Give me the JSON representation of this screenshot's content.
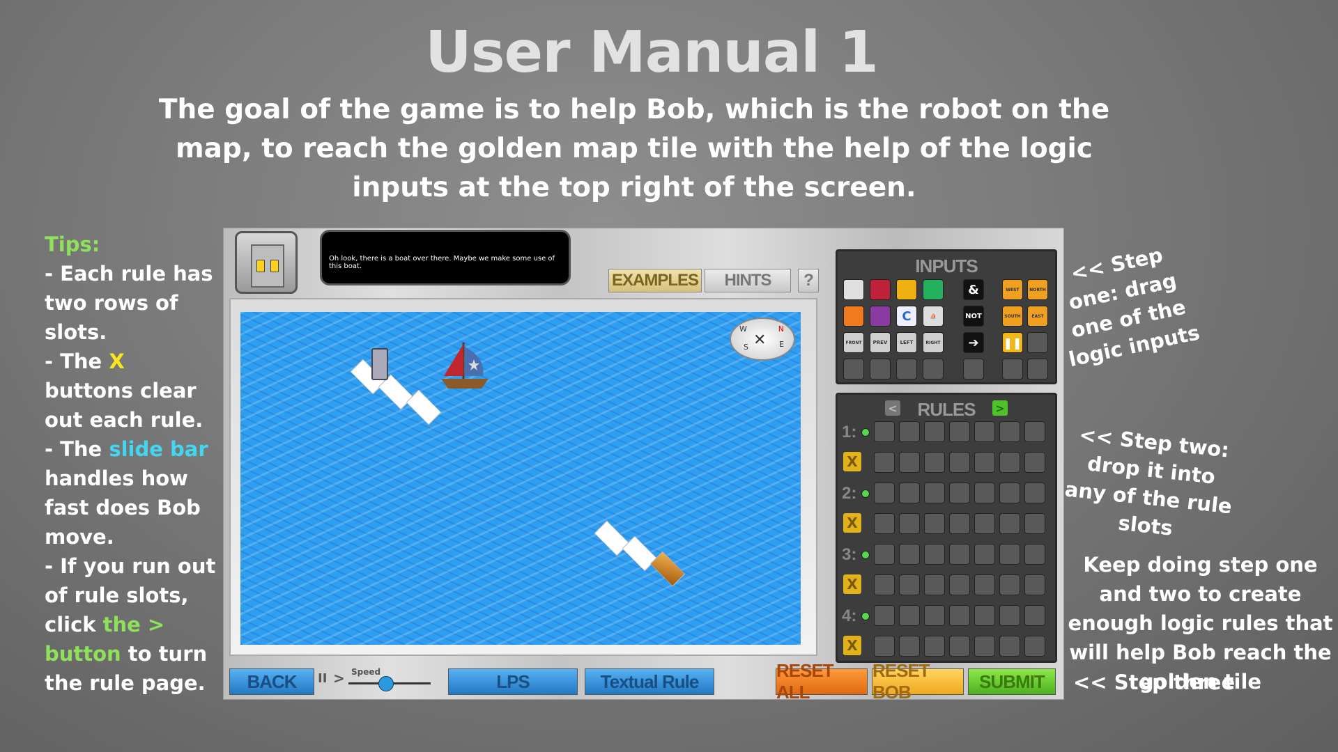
{
  "title": "User Manual 1",
  "intro": "The goal of the game is to help Bob, which is the robot on the map, to reach the golden map tile with the help of the logic inputs at the top right of the screen.",
  "tips": {
    "heading": "Tips:",
    "line1": "- Each rule has two rows of slots.",
    "line2_pre": "- The ",
    "line2_x": "X",
    "line2_post": " buttons clear out each rule.",
    "line3_pre": "- The ",
    "line3_highlight": "slide bar",
    "line3_post": " handles how fast does Bob move.",
    "line4_pre": "- If you run out of rule slots, click ",
    "line4_highlight": "the > button",
    "line4_post": " to turn the rule page."
  },
  "notes": {
    "step1": "<< Step one: drag one of the logic inputs",
    "step2": "<< Step two: drop it into any of the rule slots",
    "step3": "Keep doing step one and two to create enough logic rules that will help Bob reach the golden tile",
    "step4": "<< Step three"
  },
  "game": {
    "speech": "Oh look, there is a boat over there. Maybe we make some use of this boat.",
    "buttons": {
      "examples": "EXAMPLES",
      "hints": "HINTS",
      "help": "?",
      "back": "BACK",
      "pause": "II",
      "play": ">",
      "speed": "Speed",
      "lps": "LPS",
      "textual_rule": "Textual Rule",
      "reset_all": "RESET ALL",
      "reset_bob": "RESET BOB",
      "submit": "SUBMIT"
    },
    "compass": {
      "w": "W",
      "n": "N",
      "s": "S",
      "e": "E"
    },
    "inputs": {
      "title": "INPUTS",
      "and": "&",
      "not": "NOT",
      "front": "FRONT",
      "prev": "PREV",
      "left": "LEFT",
      "right": "RIGHT",
      "west": "WEST",
      "north": "NORTH",
      "south": "SOUTH",
      "east": "EAST"
    },
    "rules": {
      "title": "RULES",
      "prev": "<",
      "next": ">",
      "x": "X",
      "nums": [
        "1:",
        "2:",
        "3:",
        "4:"
      ]
    },
    "speed_level": 0.45
  },
  "colors": {
    "tips_green": "#8fe05a",
    "x_yellow": "#ffe51e",
    "slide_cyan": "#43d6f0",
    "sea_blue": "#2f9df0"
  }
}
